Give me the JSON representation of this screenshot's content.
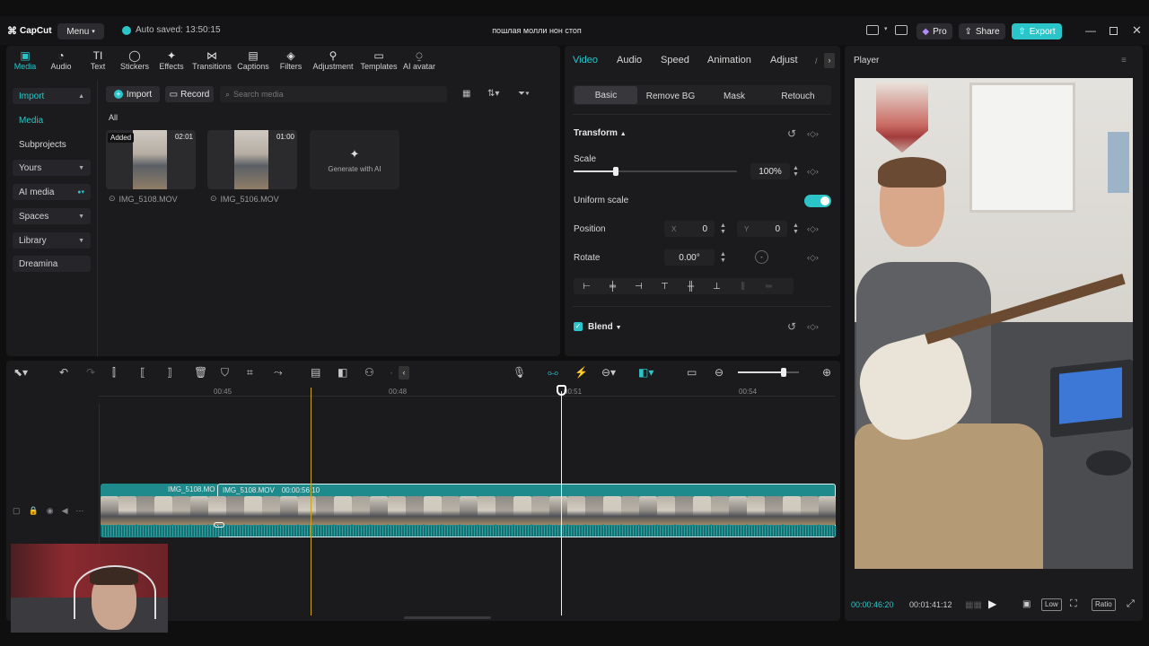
{
  "app": {
    "name": "CapCut",
    "menu_label": "Menu",
    "autosave": "Auto saved: 13:50:15",
    "project_title": "пошлая молли нон стоп"
  },
  "titlebar": {
    "pro_label": "Pro",
    "share_label": "Share",
    "export_label": "Export"
  },
  "toolbar": {
    "items": [
      {
        "label": "Media",
        "icon": "media-icon"
      },
      {
        "label": "Audio",
        "icon": "audio-icon"
      },
      {
        "label": "Text",
        "icon": "text-icon"
      },
      {
        "label": "Stickers",
        "icon": "stickers-icon"
      },
      {
        "label": "Effects",
        "icon": "effects-icon"
      },
      {
        "label": "Transitions",
        "icon": "transitions-icon"
      },
      {
        "label": "Captions",
        "icon": "captions-icon"
      },
      {
        "label": "Filters",
        "icon": "filters-icon"
      },
      {
        "label": "Adjustment",
        "icon": "adjustment-icon"
      },
      {
        "label": "Templates",
        "icon": "templates-icon"
      },
      {
        "label": "AI avatar",
        "icon": "ai-avatar-icon"
      }
    ]
  },
  "sidebar": {
    "items": [
      {
        "label": "Import"
      },
      {
        "label": "Media"
      },
      {
        "label": "Subprojects"
      },
      {
        "label": "Yours"
      },
      {
        "label": "AI media"
      },
      {
        "label": "Spaces"
      },
      {
        "label": "Library"
      },
      {
        "label": "Dreamina"
      }
    ]
  },
  "media": {
    "import_label": "Import",
    "record_label": "Record",
    "search_placeholder": "Search media",
    "filter_label": "All",
    "items": [
      {
        "name": "IMG_5108.MOV",
        "duration": "02:01",
        "badge": "Added"
      },
      {
        "name": "IMG_5106.MOV",
        "duration": "01:00"
      }
    ],
    "generate_label": "Generate with AI"
  },
  "inspector": {
    "tabs": [
      "Video",
      "Audio",
      "Speed",
      "Animation",
      "Adjust"
    ],
    "subtabs": [
      "Basic",
      "Remove BG",
      "Mask",
      "Retouch"
    ],
    "transform_label": "Transform",
    "scale_label": "Scale",
    "scale_value": "100%",
    "scale_fraction": 0.26,
    "uniform_scale_label": "Uniform scale",
    "uniform_scale_on": true,
    "position_label": "Position",
    "pos_x_label": "X",
    "pos_x": "0",
    "pos_y_label": "Y",
    "pos_y": "0",
    "rotate_label": "Rotate",
    "rotate_value": "0.00°",
    "blend_label": "Blend"
  },
  "player": {
    "title": "Player",
    "current_time": "00:00:46:20",
    "total_time": "00:01:41:12",
    "quality_label": "Low",
    "ratio_label": "Ratio"
  },
  "timeline": {
    "ruler": [
      "00:45",
      "00:48",
      "00:51",
      "00:54"
    ],
    "clip1_label": "IMG_5108.MO",
    "clip2_label": "IMG_5108.MOV",
    "clip2_time": "00:00:56:10",
    "zoom_fraction": 0.75
  },
  "colors": {
    "accent": "#2bc5c9",
    "panel": "#1b1b1d",
    "background": "#0f0f10",
    "clip": "#1f8a8c"
  }
}
